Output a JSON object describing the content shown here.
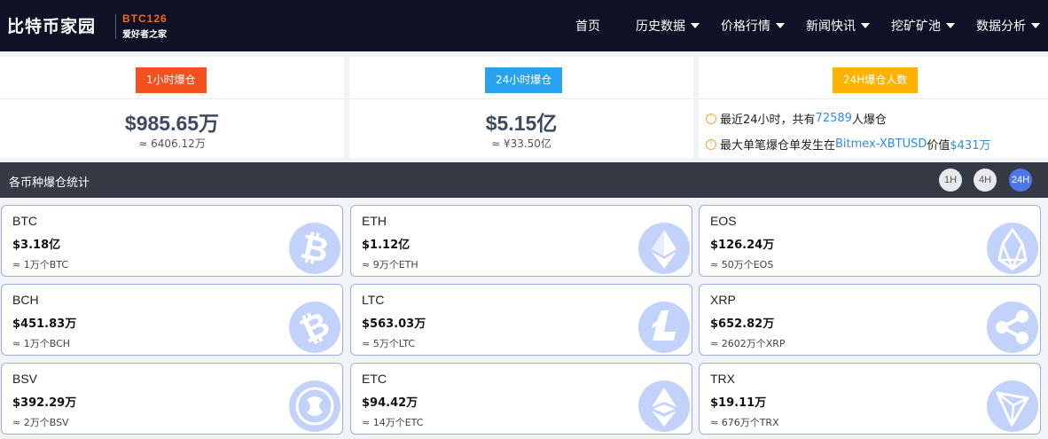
{
  "header": {
    "logo_cn": "比特币家园",
    "logo_en": "BTC126",
    "logo_sub": "爱好者之家",
    "nav": [
      {
        "label": "首页"
      },
      {
        "label": "历史数据"
      },
      {
        "label": "价格行情"
      },
      {
        "label": "新闻快讯"
      },
      {
        "label": "挖矿矿池"
      },
      {
        "label": "数据分析"
      }
    ]
  },
  "summary": {
    "hour1": {
      "badge": "1小时爆仓",
      "value": "$985.65万",
      "sub": "≈ 6406.12万"
    },
    "hour24": {
      "badge": "24小时爆仓",
      "value": "$5.15亿",
      "sub": "≈ ¥33.50亿"
    },
    "people": {
      "badge": "24H爆仓人数",
      "line1_pre": "最近24小时，共有",
      "line1_num": "72589",
      "line1_post": "人爆仓",
      "line2_pre": "最大单笔爆仓单发生在",
      "line2_exchange": "Bitmex-XBTUSD",
      "line2_mid": "价值",
      "line2_value": "$431万"
    }
  },
  "section": {
    "title": "各币种爆仓统计",
    "ranges": [
      "1H",
      "4H",
      "24H"
    ],
    "active_range": "24H"
  },
  "coins": [
    {
      "name": "BTC",
      "value": "$3.18亿",
      "sub": "≈ 1万个BTC",
      "icon": "bitcoin-icon"
    },
    {
      "name": "ETH",
      "value": "$1.12亿",
      "sub": "≈ 9万个ETH",
      "icon": "ethereum-icon"
    },
    {
      "name": "EOS",
      "value": "$126.24万",
      "sub": "≈ 50万个EOS",
      "icon": "eos-icon"
    },
    {
      "name": "BCH",
      "value": "$451.83万",
      "sub": "≈ 1万个BCH",
      "icon": "bitcoin-cash-icon"
    },
    {
      "name": "LTC",
      "value": "$563.03万",
      "sub": "≈ 5万个LTC",
      "icon": "litecoin-icon"
    },
    {
      "name": "XRP",
      "value": "$652.82万",
      "sub": "≈ 2602万个XRP",
      "icon": "ripple-icon"
    },
    {
      "name": "BSV",
      "value": "$392.29万",
      "sub": "≈ 2万个BSV",
      "icon": "bitcoin-sv-icon"
    },
    {
      "name": "ETC",
      "value": "$94.42万",
      "sub": "≈ 14万个ETC",
      "icon": "ethereum-classic-icon"
    },
    {
      "name": "TRX",
      "value": "$19.11万",
      "sub": "≈ 676万个TRX",
      "icon": "tron-icon"
    }
  ],
  "colors": {
    "header_bg": "#0f1126",
    "badge_1h": "#f4511e",
    "badge_24h": "#29a3f0",
    "badge_people": "#ffb300",
    "link": "#2f8de4",
    "active_pill": "#4b77e8",
    "card_border": "#9ab0e8"
  }
}
